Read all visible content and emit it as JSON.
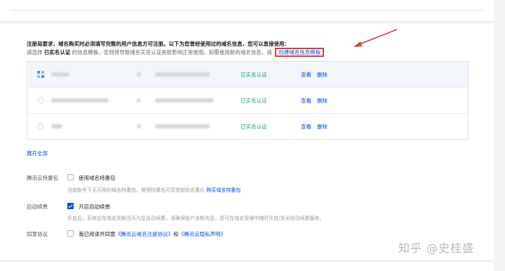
{
  "notice": {
    "line1": "注册局要求，域名购买时必须填写完整的用户信息方可注册。以下为您曾经使用过的域名信息，您可以直接使用：",
    "line2_prefix": "请选择",
    "line2_bold": "已实名认证",
    "line2_suffix": "的信息模板，否则将导致域名实名认证失败影响正常使用。如需使用新的域名信息，请",
    "create_link": "创建域名信息模板"
  },
  "templates": [
    {
      "status": "已实名认证",
      "view": "查看",
      "delete": "删除",
      "selected": true
    },
    {
      "status": "已实名认证",
      "view": "查看",
      "delete": "删除",
      "selected": false
    },
    {
      "status": "已实名认证",
      "view": "查看",
      "delete": "删除",
      "selected": false
    }
  ],
  "expand_all": "展开全部",
  "form": {
    "package": {
      "label": "腾讯云特惠包",
      "checkbox_label": "使用域名特惠包",
      "checked": false,
      "hint": "当前账号下无可用的域名特惠包，使用特惠包可享受超低优惠价",
      "hint_link": "购买域名特惠包"
    },
    "renew": {
      "label": "自动续费",
      "checkbox_label": "开启自动续费",
      "checked": true,
      "hint": "开启后，系统会在域名到期当天为您自动续费，请确保账户余额充足。您可在域名管理中随时开启/关闭自动续费服务。"
    },
    "agreement": {
      "label": "同意协议",
      "text_prefix": "我已阅读并同意",
      "link1": "《腾讯云域名注册协议》",
      "and": "和",
      "link2": "《腾讯云隐私声明》",
      "checked": false
    }
  },
  "watermark": "知乎 @史桂盛",
  "colors": {
    "link": "#0052d9",
    "verified": "#19a15f",
    "highlight_box": "#e53935"
  }
}
